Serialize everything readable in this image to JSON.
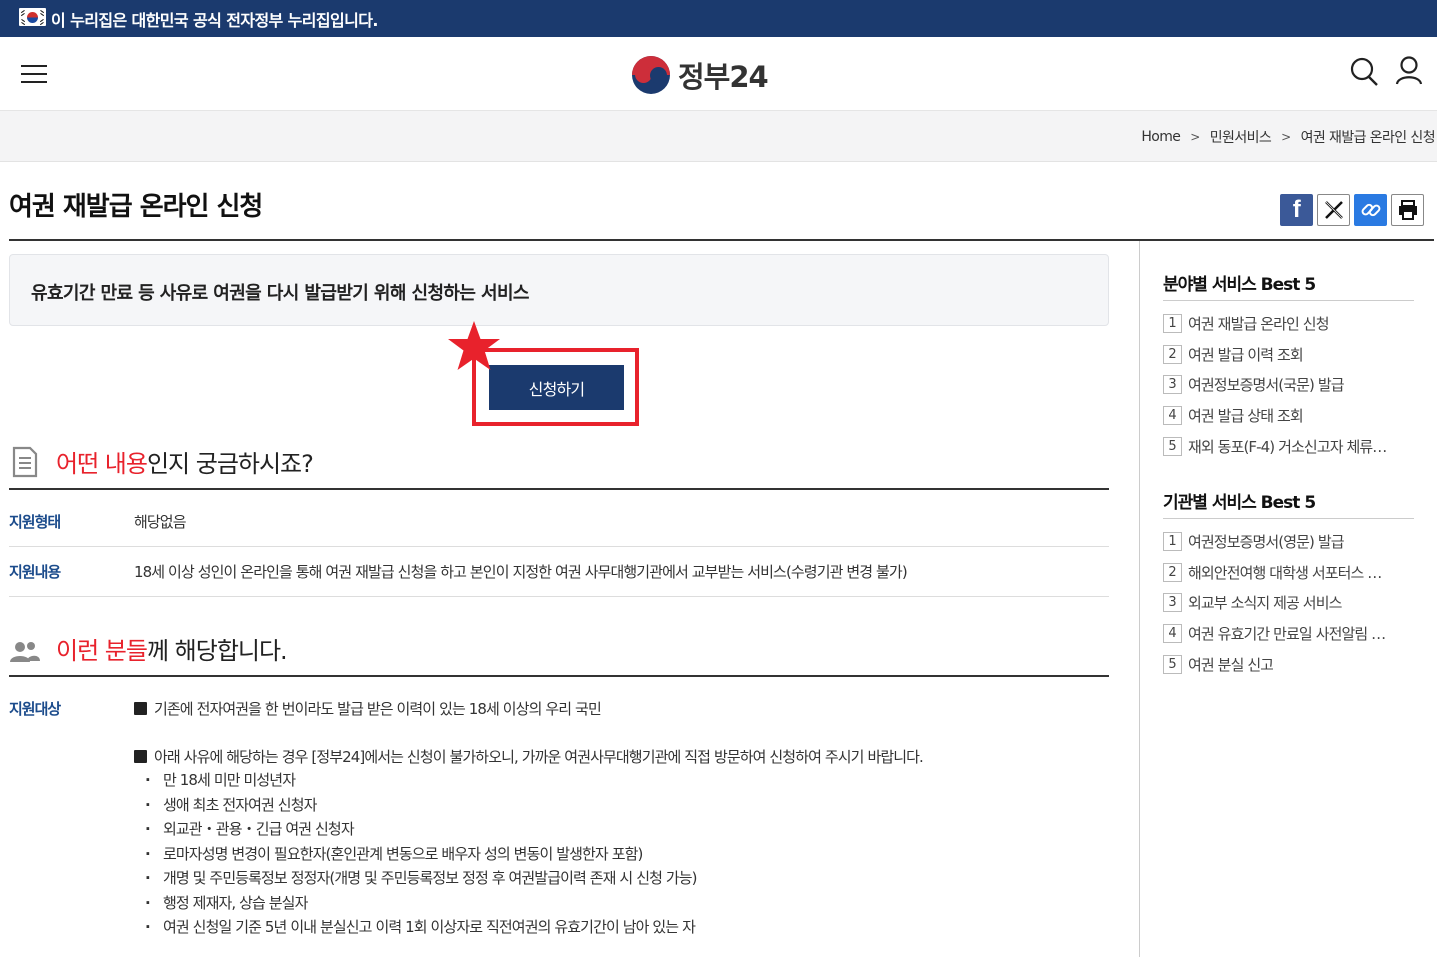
{
  "gov_banner": {
    "text": "이 누리집은 대한민국 공식 전자정부 누리집입니다."
  },
  "header": {
    "logo_text": "정부24"
  },
  "breadcrumb": [
    "Home",
    "민원서비스",
    "여권 재발급 온라인 신청"
  ],
  "page": {
    "title": "여권 재발급 온라인 신청",
    "summary": "유효기간 만료 등 사유로 여권을 다시 발급받기 위해 신청하는 서비스",
    "apply_label": "신청하기"
  },
  "share": {
    "facebook_label": "f"
  },
  "section1": {
    "title_highlight": "어떤 내용",
    "title_rest": "인지 궁금하시죠?",
    "rows": [
      {
        "label": "지원형태",
        "value": "해당없음"
      },
      {
        "label": "지원내용",
        "value": "18세 이상 성인이 온라인을 통해 여권 재발급 신청을 하고 본인이 지정한 여권 사무대행기관에서 교부받는 서비스(수령기관 변경 불가)"
      }
    ]
  },
  "section2": {
    "title_highlight": "이런 분들",
    "title_rest": "께 해당합니다.",
    "label": "지원대상",
    "item1": "기존에 전자여권을 한 번이라도 발급 받은 이력이 있는 18세 이상의 우리 국민",
    "item2": "아래 사유에 해당하는 경우 [정부24]에서는 신청이 불가하오니, 가까운 여권사무대행기관에 직접 방문하여 신청하여 주시기 바랍니다.",
    "sub_items": [
      "만 18세 미만 미성년자",
      "생애 최초 전자여권 신청자",
      "외교관・관용・긴급 여권 신청자",
      "로마자성명 변경이 필요한자(혼인관계 변동으로 배우자 성의 변동이 발생한자 포함)",
      "개명 및 주민등록정보 정정자(개명 및 주민등록정보 정정 후 여권발급이력 존재 시 신청 가능)",
      "행정 제재자, 상습 분실자",
      "여권 신청일 기준 5년 이내 분실신고 이력 1회 이상자로 직전여권의 유효기간이 남아 있는 자"
    ]
  },
  "sidebar": {
    "field_title": "분야별 서비스 Best 5",
    "field_items": [
      {
        "num": "1",
        "label": "여권 재발급 온라인 신청"
      },
      {
        "num": "2",
        "label": "여권 발급 이력 조회"
      },
      {
        "num": "3",
        "label": "여권정보증명서(국문) 발급"
      },
      {
        "num": "4",
        "label": "여권 발급 상태 조회"
      },
      {
        "num": "5",
        "label": "재외 동포(F-4) 거소신고자 체류 …"
      }
    ],
    "agency_title": "기관별 서비스 Best 5",
    "agency_items": [
      {
        "num": "1",
        "label": "여권정보증명서(영문) 발급"
      },
      {
        "num": "2",
        "label": "해외안전여행 대학생 서포터스 …"
      },
      {
        "num": "3",
        "label": "외교부 소식지 제공 서비스"
      },
      {
        "num": "4",
        "label": "여권 유효기간 만료일 사전알림 …"
      },
      {
        "num": "5",
        "label": "여권 분실 신고"
      }
    ]
  },
  "colors": {
    "navy": "#1b3a6e",
    "accent_red": "#e8222c",
    "label_blue": "#1c4c8c"
  }
}
